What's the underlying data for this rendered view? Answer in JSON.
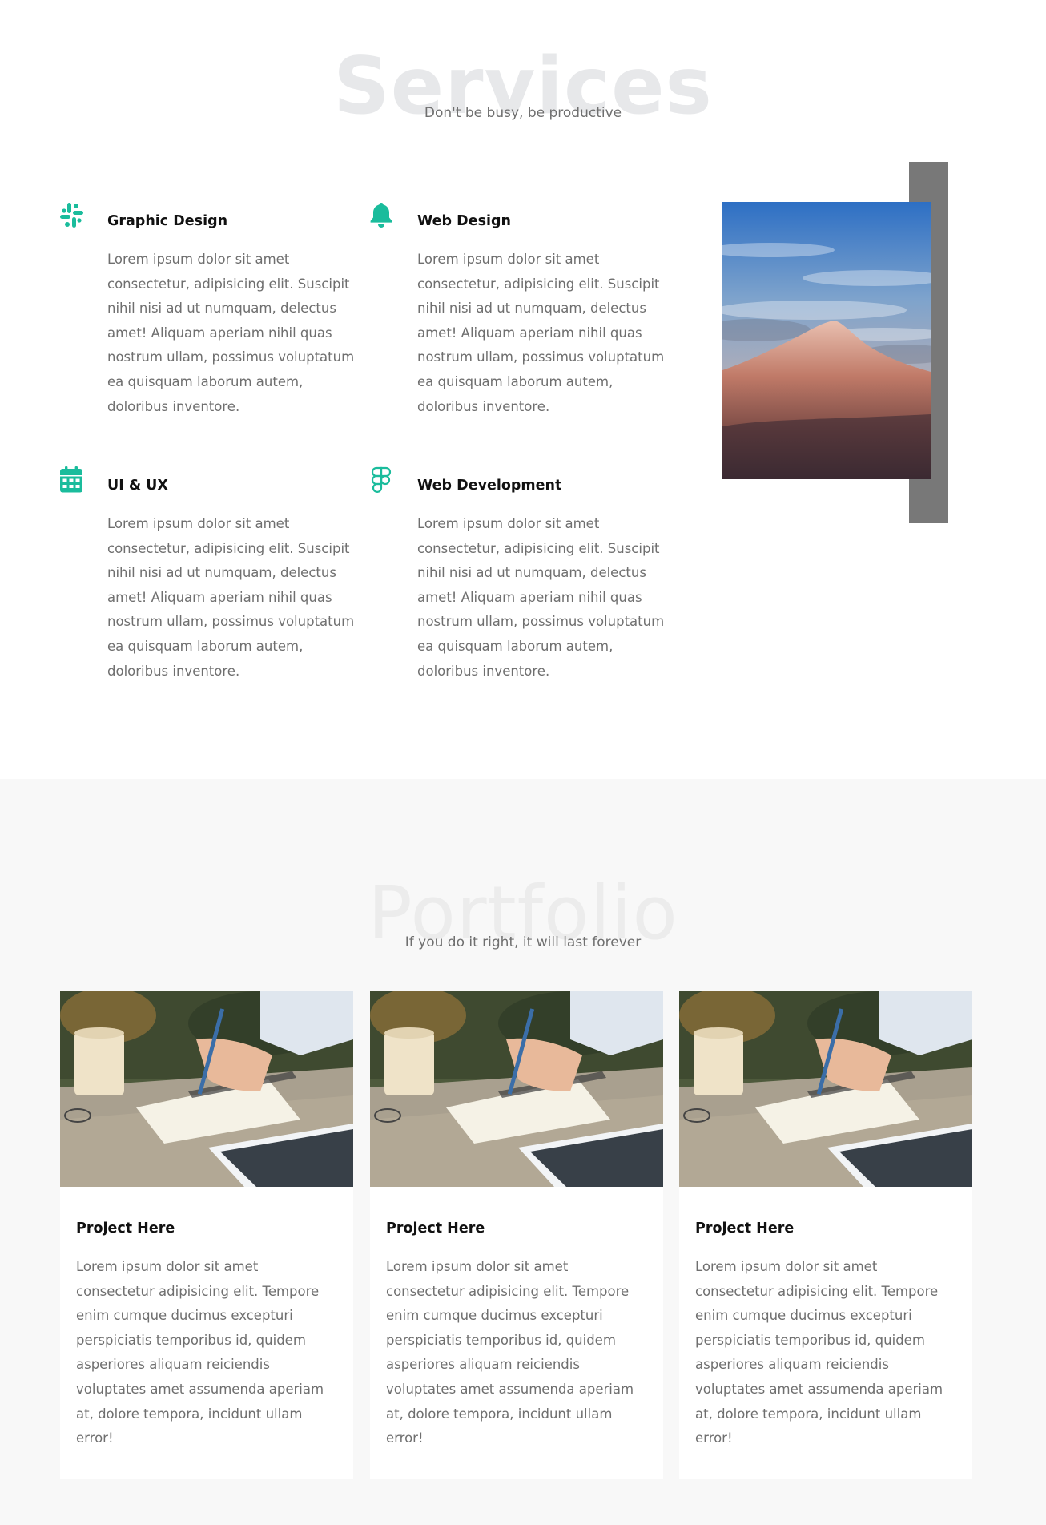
{
  "services": {
    "title": "Services",
    "subtitle": "Don't be busy, be productive",
    "items": [
      {
        "icon": "slack-icon",
        "title": "Graphic Design",
        "text": "Lorem ipsum dolor sit amet consectetur, adipisicing elit. Suscipit nihil nisi ad ut numquam, delectus amet! Aliquam aperiam nihil quas nostrum ullam, possimus voluptatum ea quisquam laborum autem, doloribus inventore."
      },
      {
        "icon": "bell-icon",
        "title": "Web Design",
        "text": "Lorem ipsum dolor sit amet consectetur, adipisicing elit. Suscipit nihil nisi ad ut numquam, delectus amet! Aliquam aperiam nihil quas nostrum ullam, possimus voluptatum ea quisquam laborum autem, doloribus inventore."
      },
      {
        "icon": "calendar-icon",
        "title": "UI & UX",
        "text": "Lorem ipsum dolor sit amet consectetur, adipisicing elit. Suscipit nihil nisi ad ut numquam, delectus amet! Aliquam aperiam nihil quas nostrum ullam, possimus voluptatum ea quisquam laborum autem, doloribus inventore."
      },
      {
        "icon": "figma-icon",
        "title": "Web Development",
        "text": "Lorem ipsum dolor sit amet consectetur, adipisicing elit. Suscipit nihil nisi ad ut numquam, delectus amet! Aliquam aperiam nihil quas nostrum ullam, possimus voluptatum ea quisquam laborum autem, doloribus inventore."
      }
    ],
    "image": "mountain-photo"
  },
  "portfolio": {
    "title": "Portfolio",
    "subtitle": "If you do it right, it will last forever",
    "cards": [
      {
        "image": "notebook-writing-photo",
        "title": "Project Here",
        "text": "Lorem ipsum dolor sit amet consectetur adipisicing elit. Tempore enim cumque ducimus excepturi perspiciatis temporibus id, quidem asperiores aliquam reiciendis voluptates amet assumenda aperiam at, dolore tempora, incidunt ullam error!"
      },
      {
        "image": "notebook-writing-photo",
        "title": "Project Here",
        "text": "Lorem ipsum dolor sit amet consectetur adipisicing elit. Tempore enim cumque ducimus excepturi perspiciatis temporibus id, quidem asperiores aliquam reiciendis voluptates amet assumenda aperiam at, dolore tempora, incidunt ullam error!"
      },
      {
        "image": "notebook-writing-photo",
        "title": "Project Here",
        "text": "Lorem ipsum dolor sit amet consectetur adipisicing elit. Tempore enim cumque ducimus excepturi perspiciatis temporibus id, quidem asperiores aliquam reiciendis voluptates amet assumenda aperiam at, dolore tempora, incidunt ullam error!"
      }
    ]
  },
  "colors": {
    "accent": "#1abc9c",
    "heading": "#111111",
    "body_text": "#6f6f6f",
    "watermark": "#e7e8ea",
    "section_bg": "#f8f8f8",
    "frame_bar": "#787878"
  }
}
